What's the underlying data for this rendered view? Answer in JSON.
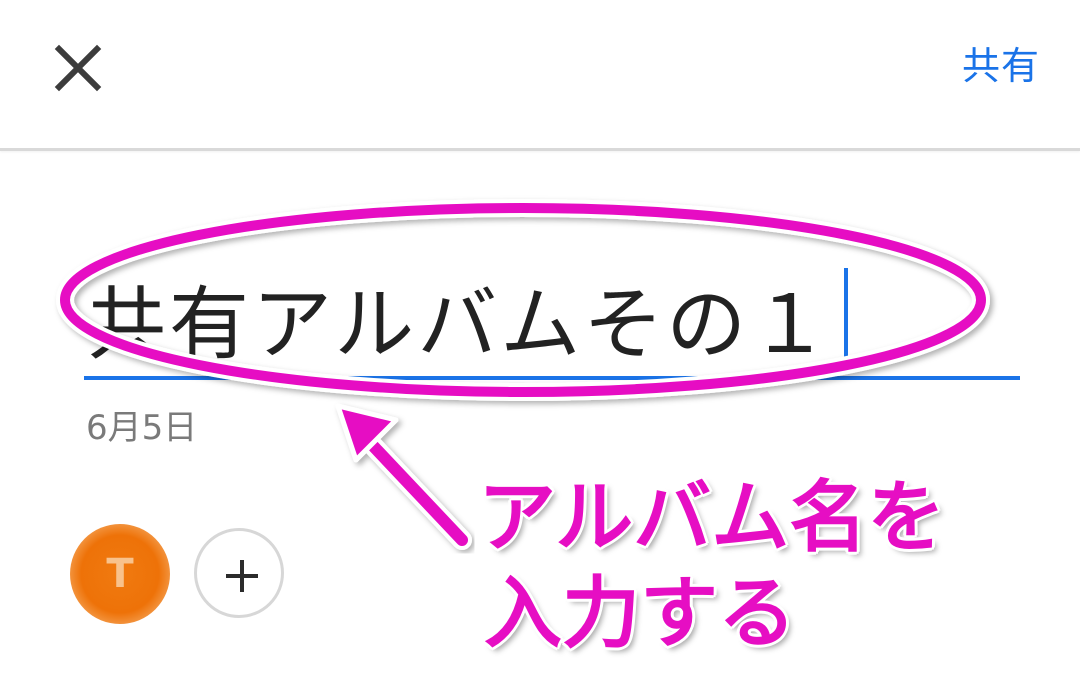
{
  "toolbar": {
    "close_icon": "close-icon",
    "share_label": "共有"
  },
  "album": {
    "title_value": "共有アルバムその１",
    "date": "6月5日"
  },
  "members": {
    "avatar_initial": "T",
    "add_icon": "plus-icon"
  },
  "annotation": {
    "line1": "アルバム名を",
    "line2": "入力する",
    "color": "#e60ec3"
  },
  "colors": {
    "accent": "#1a73e8",
    "annotation": "#e60ec3",
    "avatar": "#ee7208"
  }
}
